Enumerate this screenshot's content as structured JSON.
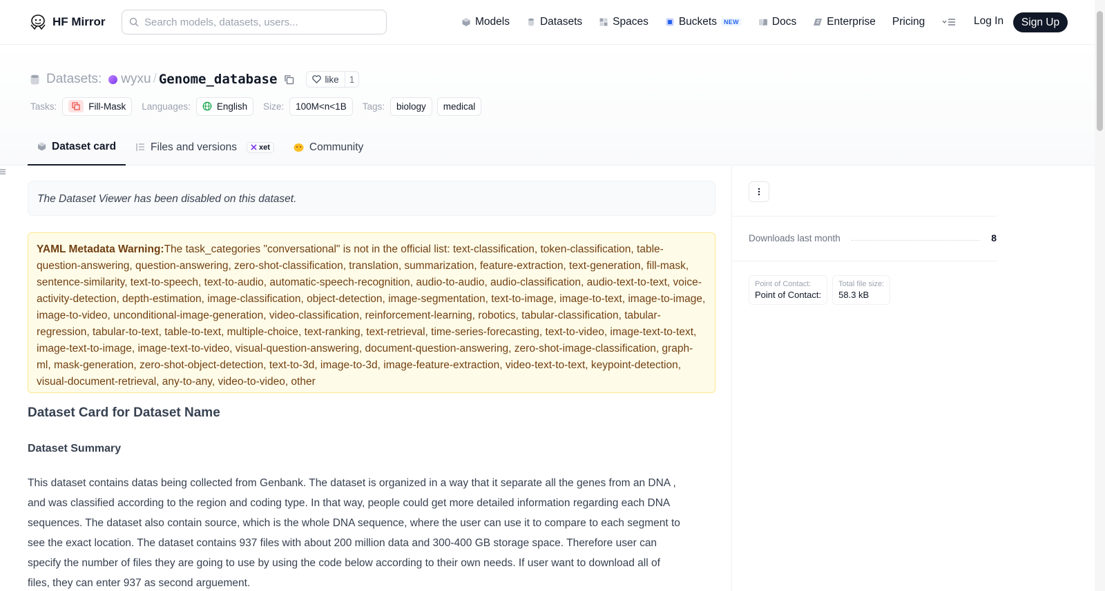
{
  "nav": {
    "brand": "HF Mirror",
    "search_placeholder": "Search models, datasets, users...",
    "links": [
      {
        "label": "Models",
        "icon": "cube-icon"
      },
      {
        "label": "Datasets",
        "icon": "database-icon"
      },
      {
        "label": "Spaces",
        "icon": "grid-icon"
      },
      {
        "label": "Buckets",
        "icon": "bucket-icon",
        "badge": "NEW"
      },
      {
        "label": "Docs",
        "icon": "book-icon"
      },
      {
        "label": "Enterprise",
        "icon": "enterprise-icon"
      },
      {
        "label": "Pricing"
      }
    ],
    "login": "Log In",
    "signup": "Sign Up"
  },
  "header": {
    "type_label": "Datasets:",
    "owner": "wyxu",
    "separator": "/",
    "repo": "Genome_database",
    "like_label": "like",
    "like_count": "1",
    "tags": {
      "tasks_label": "Tasks:",
      "task": "Fill-Mask",
      "languages_label": "Languages:",
      "language": "English",
      "size_label": "Size:",
      "size": "100M<n<1B",
      "tags_label": "Tags:",
      "tag_list": [
        "biology",
        "medical"
      ]
    }
  },
  "tabs": {
    "dataset_card": "Dataset card",
    "files": "Files and versions",
    "xet": "xet",
    "community": "Community"
  },
  "main": {
    "viewer_notice": "The Dataset Viewer has been disabled on this dataset.",
    "warning_title": "YAML Metadata Warning:",
    "warning_text": "The task_categories \"conversational\" is not in the official list: text-classification, token-classification, table-question-answering, question-answering, zero-shot-classification, translation, summarization, feature-extraction, text-generation, fill-mask, sentence-similarity, text-to-speech, text-to-audio, automatic-speech-recognition, audio-to-audio, audio-classification, audio-text-to-text, voice-activity-detection, depth-estimation, image-classification, object-detection, image-segmentation, text-to-image, image-to-text, image-to-image, image-to-video, unconditional-image-generation, video-classification, reinforcement-learning, robotics, tabular-classification, tabular-regression, tabular-to-text, table-to-text, multiple-choice, text-ranking, text-retrieval, time-series-forecasting, text-to-video, image-text-to-text, image-text-to-image, image-text-to-video, visual-question-answering, document-question-answering, zero-shot-image-classification, graph-ml, mask-generation, zero-shot-object-detection, text-to-3d, image-to-3d, image-feature-extraction, video-text-to-text, keypoint-detection, visual-document-retrieval, any-to-any, video-to-video, other",
    "card_title": "Dataset Card for Dataset Name",
    "summary_title": "Dataset Summary",
    "summary_text": "This dataset contains datas being collected from Genbank. The dataset is organized in a way that it separate all the genes from an DNA , and was classified according to the region and coding type. In that way, people could get more detailed information regarding each DNA sequences. The dataset also contain source, which is the whole DNA sequence, where the user can use it to compare to each segment to see the exact location. The dataset contains 937 files with about 200 million data and 300-400 GB storage space. Therefore user can specify the number of files they are going to use by using the code below according to their own needs. If user want to download all of files, they can enter 937 as second arguement."
  },
  "sidebar": {
    "downloads_label": "Downloads last month",
    "downloads_value": "8",
    "poc_key": "Point of Contact:",
    "poc_value": "Point of Contact:",
    "size_key": "Total file size:",
    "size_value": "58.3 kB"
  }
}
